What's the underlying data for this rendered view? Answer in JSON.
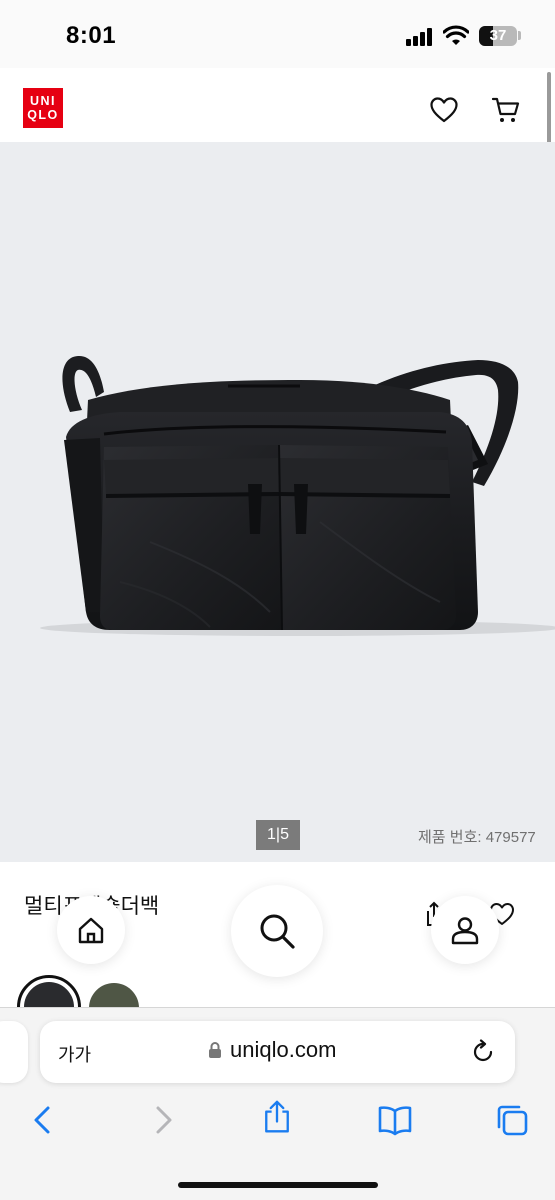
{
  "status_bar": {
    "time": "8:01",
    "battery_level": "37",
    "battery_fraction": 0.37,
    "signal_icon": "cellular-signal-icon",
    "wifi_icon": "wifi-icon"
  },
  "header": {
    "logo_line1": "UNI",
    "logo_line2": "QLO",
    "brand_color": "#e60012",
    "wishlist_icon": "heart-icon",
    "cart_icon": "cart-icon"
  },
  "gallery": {
    "pager": "1|5",
    "product_number": "제품 번호: 479577",
    "background_color": "#ebedf0"
  },
  "product": {
    "name": "멀티포켓숄더백",
    "share_icon": "share-icon",
    "wishlist_icon": "heart-icon"
  },
  "floating_nav": {
    "home_icon": "home-icon",
    "search_icon": "search-icon",
    "account_icon": "user-icon"
  },
  "colors": {
    "swatches": [
      {
        "color": "#2a2b2e",
        "selected": true
      },
      {
        "color": "#4f5645",
        "selected": false
      }
    ]
  },
  "browser": {
    "text_size_label": "가가",
    "url": "uniqlo.com",
    "lock_icon": "lock-icon",
    "reload_icon": "reload-icon",
    "toolbar": {
      "back_icon": "chevron-left-icon",
      "forward_icon": "chevron-right-icon",
      "share_icon": "share-icon",
      "bookmarks_icon": "book-icon",
      "tabs_icon": "tabs-icon"
    }
  }
}
